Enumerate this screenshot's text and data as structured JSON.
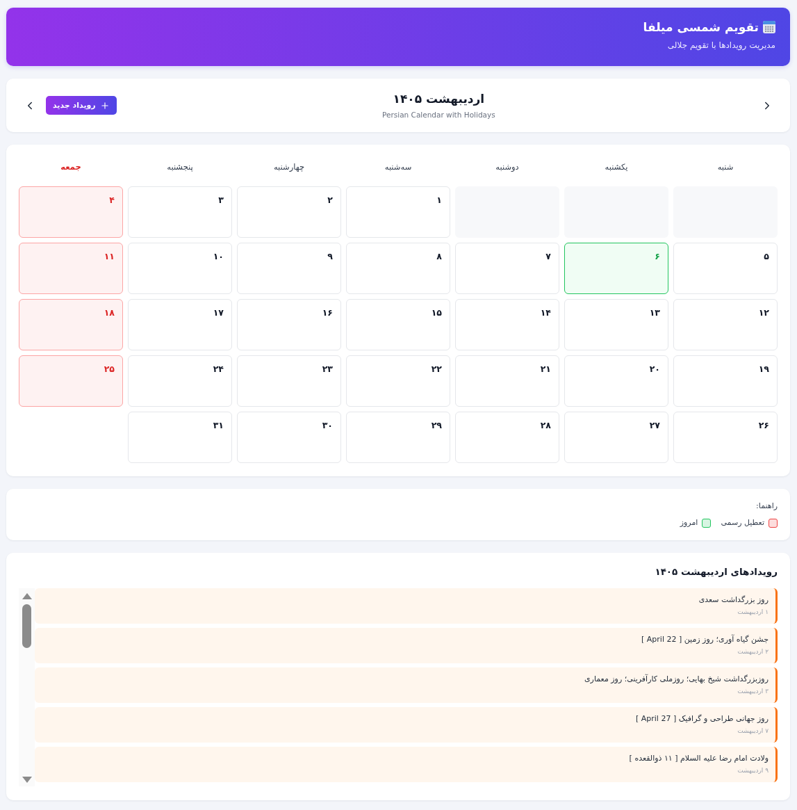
{
  "header": {
    "title": "تقویم شمسی میلفا",
    "subtitle": "مدیریت رویدادها با تقویم جلالی"
  },
  "nav": {
    "title": "اردیبهشت ۱۴۰۵",
    "subtitle": "Persian Calendar with Holidays",
    "new_button": "رویداد جدید"
  },
  "calendar": {
    "weekdays": [
      {
        "label": "شنبه",
        "holiday": false
      },
      {
        "label": "یکشنبه",
        "holiday": false
      },
      {
        "label": "دوشنبه",
        "holiday": false
      },
      {
        "label": "سه‌شنبه",
        "holiday": false
      },
      {
        "label": "چهارشنبه",
        "holiday": false
      },
      {
        "label": "پنجشنبه",
        "holiday": false
      },
      {
        "label": "جمعه",
        "holiday": true
      }
    ],
    "cells": [
      {
        "kind": "blank"
      },
      {
        "kind": "blank"
      },
      {
        "kind": "blank"
      },
      {
        "kind": "day",
        "label": "۱",
        "holiday": false,
        "today": false
      },
      {
        "kind": "day",
        "label": "۲",
        "holiday": false,
        "today": false
      },
      {
        "kind": "day",
        "label": "۳",
        "holiday": false,
        "today": false
      },
      {
        "kind": "day",
        "label": "۴",
        "holiday": true,
        "today": false
      },
      {
        "kind": "day",
        "label": "۵",
        "holiday": false,
        "today": false
      },
      {
        "kind": "day",
        "label": "۶",
        "holiday": false,
        "today": true
      },
      {
        "kind": "day",
        "label": "۷",
        "holiday": false,
        "today": false
      },
      {
        "kind": "day",
        "label": "۸",
        "holiday": false,
        "today": false
      },
      {
        "kind": "day",
        "label": "۹",
        "holiday": false,
        "today": false
      },
      {
        "kind": "day",
        "label": "۱۰",
        "holiday": false,
        "today": false
      },
      {
        "kind": "day",
        "label": "۱۱",
        "holiday": true,
        "today": false
      },
      {
        "kind": "day",
        "label": "۱۲",
        "holiday": false,
        "today": false
      },
      {
        "kind": "day",
        "label": "۱۳",
        "holiday": false,
        "today": false
      },
      {
        "kind": "day",
        "label": "۱۴",
        "holiday": false,
        "today": false
      },
      {
        "kind": "day",
        "label": "۱۵",
        "holiday": false,
        "today": false
      },
      {
        "kind": "day",
        "label": "۱۶",
        "holiday": false,
        "today": false
      },
      {
        "kind": "day",
        "label": "۱۷",
        "holiday": false,
        "today": false
      },
      {
        "kind": "day",
        "label": "۱۸",
        "holiday": true,
        "today": false
      },
      {
        "kind": "day",
        "label": "۱۹",
        "holiday": false,
        "today": false
      },
      {
        "kind": "day",
        "label": "۲۰",
        "holiday": false,
        "today": false
      },
      {
        "kind": "day",
        "label": "۲۱",
        "holiday": false,
        "today": false
      },
      {
        "kind": "day",
        "label": "۲۲",
        "holiday": false,
        "today": false
      },
      {
        "kind": "day",
        "label": "۲۳",
        "holiday": false,
        "today": false
      },
      {
        "kind": "day",
        "label": "۲۴",
        "holiday": false,
        "today": false
      },
      {
        "kind": "day",
        "label": "۲۵",
        "holiday": true,
        "today": false
      },
      {
        "kind": "day",
        "label": "۲۶",
        "holiday": false,
        "today": false
      },
      {
        "kind": "day",
        "label": "۲۷",
        "holiday": false,
        "today": false
      },
      {
        "kind": "day",
        "label": "۲۸",
        "holiday": false,
        "today": false
      },
      {
        "kind": "day",
        "label": "۲۹",
        "holiday": false,
        "today": false
      },
      {
        "kind": "day",
        "label": "۳۰",
        "holiday": false,
        "today": false
      },
      {
        "kind": "day",
        "label": "۳۱",
        "holiday": false,
        "today": false
      }
    ]
  },
  "legend": {
    "title": "راهنما:",
    "items": [
      {
        "label": "تعطیل رسمی",
        "color": "#ef4444"
      },
      {
        "label": "امروز",
        "color": "#22c55e"
      }
    ]
  },
  "events": {
    "title": "رویدادهای اردیبهشت ۱۴۰۵",
    "items": [
      {
        "title": "روز بزرگداشت سعدی",
        "date": "۱ اردیبهشت"
      },
      {
        "title": "جشن گیاه آوری؛ روز زمین [ April 22 ]",
        "date": "۲ اردیبهشت"
      },
      {
        "title": "روزبزرگداشت شیخ بهایی؛ روزملی کارآفرینی؛ روز معماری",
        "date": "۳ اردیبهشت"
      },
      {
        "title": "روز جهانی طراحی و گرافیک [ April 27 ]",
        "date": "۷ اردیبهشت"
      },
      {
        "title": "ولادت امام رضا علیه السلام [ ۱۱ ذوالقعده ]",
        "date": "۹ اردیبهشت"
      }
    ]
  }
}
